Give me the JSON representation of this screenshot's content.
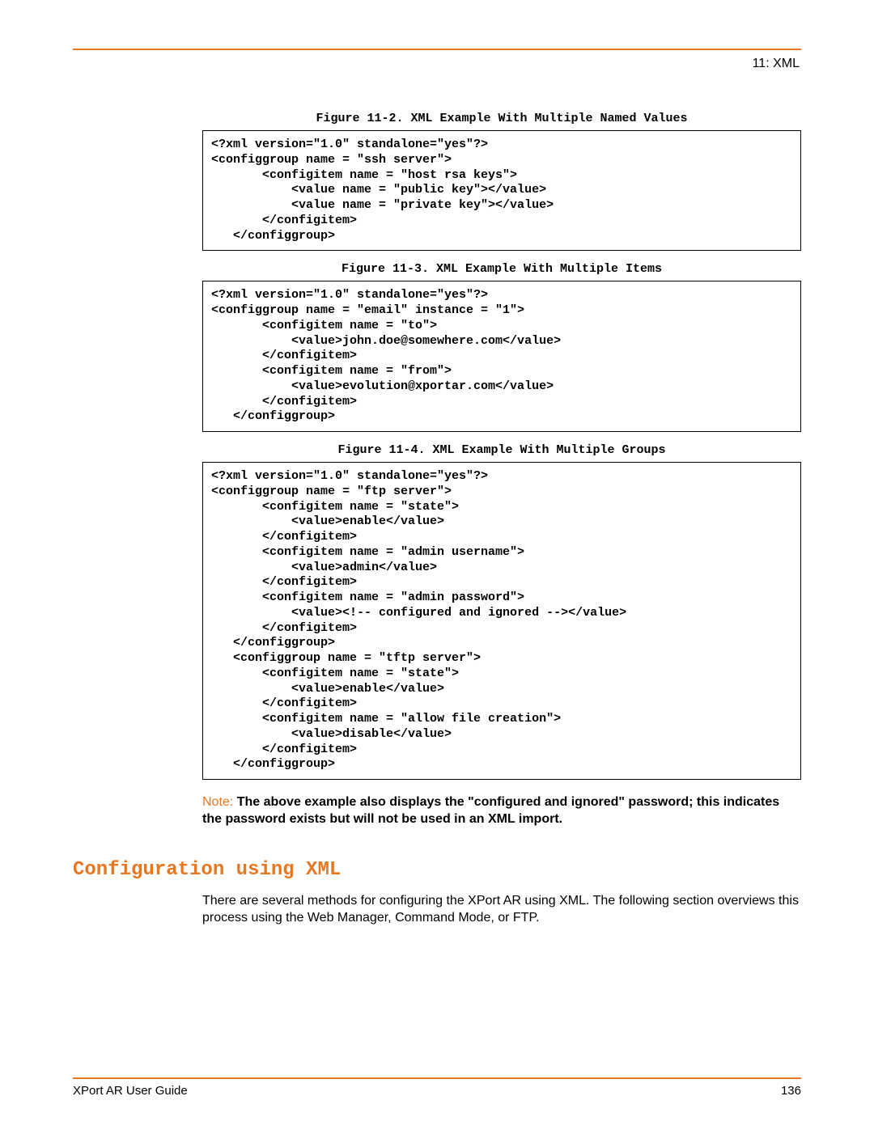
{
  "header": {
    "chapter": "11: XML"
  },
  "figures": [
    {
      "caption": "Figure 11-2. XML Example With Multiple Named Values",
      "code": "<?xml version=\"1.0\" standalone=\"yes\"?>\n<configgroup name = \"ssh server\">\n       <configitem name = \"host rsa keys\">\n           <value name = \"public key\"></value>\n           <value name = \"private key\"></value>\n       </configitem>\n   </configgroup>"
    },
    {
      "caption": "Figure 11-3. XML Example With Multiple Items",
      "code": "<?xml version=\"1.0\" standalone=\"yes\"?>\n<configgroup name = \"email\" instance = \"1\">\n       <configitem name = \"to\">\n           <value>john.doe@somewhere.com</value>\n       </configitem>\n       <configitem name = \"from\">\n           <value>evolution@xportar.com</value>\n       </configitem>\n   </configgroup>"
    },
    {
      "caption": "Figure 11-4. XML Example With Multiple Groups",
      "code": "<?xml version=\"1.0\" standalone=\"yes\"?>\n<configgroup name = \"ftp server\">\n       <configitem name = \"state\">\n           <value>enable</value>\n       </configitem>\n       <configitem name = \"admin username\">\n           <value>admin</value>\n       </configitem>\n       <configitem name = \"admin password\">\n           <value><!-- configured and ignored --></value>\n       </configitem>\n   </configgroup>\n   <configgroup name = \"tftp server\">\n       <configitem name = \"state\">\n           <value>enable</value>\n       </configitem>\n       <configitem name = \"allow file creation\">\n           <value>disable</value>\n       </configitem>\n   </configgroup>"
    }
  ],
  "note": {
    "label": "Note:",
    "text": "The above example also displays the \"configured and ignored\" password; this indicates the password exists but will not be used in an XML import."
  },
  "section": {
    "heading": "Configuration using XML",
    "body": "There are several methods for configuring the XPort AR using XML. The following section overviews this process using the Web Manager, Command Mode, or FTP."
  },
  "footer": {
    "title": "XPort AR User Guide",
    "page": "136"
  }
}
